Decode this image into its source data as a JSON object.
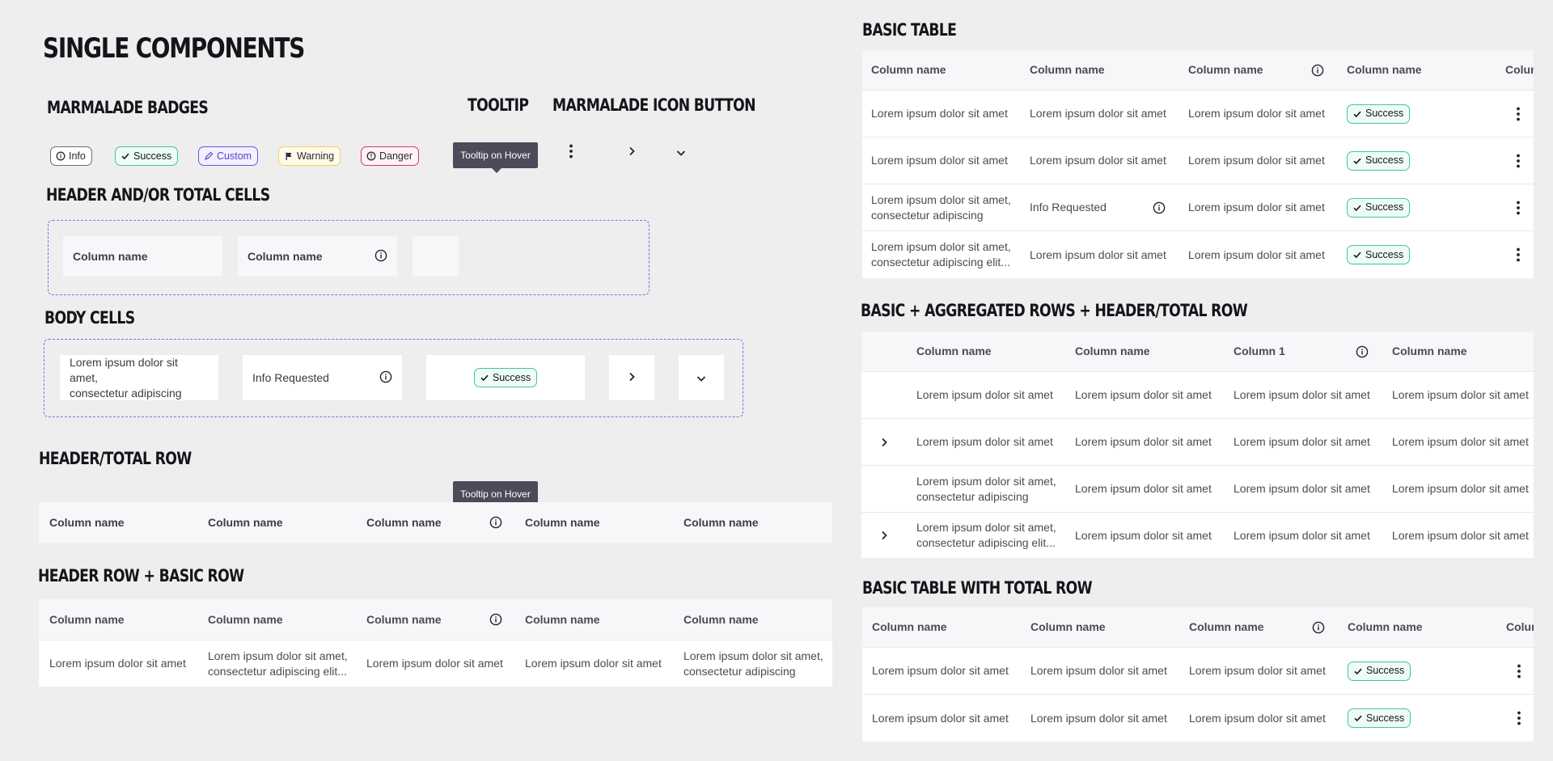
{
  "titles": {
    "single_components": "SINGLE COMPONENTS",
    "badges": "MARMALADE BADGES",
    "tooltip": "TOOLTIP",
    "icon_button": "MARMALADE ICON BUTTON",
    "header_cells": "HEADER AND/OR TOTAL CELLS",
    "body_cells": "BODY CELLS",
    "header_total_row": "HEADER/TOTAL ROW",
    "header_basic_row": "HEADER ROW + BASIC ROW",
    "basic_table": "BASIC TABLE",
    "aggregated": "BASIC + AGGREGATED ROWS + HEADER/TOTAL ROW",
    "total_row_table": "BASIC TABLE WITH TOTAL ROW"
  },
  "badges": {
    "info": "Info",
    "success": "Success",
    "custom": "Custom",
    "warning": "Warning",
    "danger": "Danger"
  },
  "tooltip_text": "Tooltip on Hover",
  "spacing_tag": "4px",
  "text": {
    "column_name": "Column name",
    "column_1": "Column 1",
    "lorem": "Lorem ipsum dolor sit amet",
    "lorem_two_line_a": "Lorem ipsum dolor sit amet,",
    "lorem_two_line_b": "consectetur adipiscing",
    "lorem_two_line_b_elided": "consectetur adipiscing elit...",
    "info_requested": "Info Requested",
    "column_truncated": "Colum"
  },
  "icons": {
    "info": "info-circle-icon",
    "check": "check-icon",
    "custom": "pen-icon",
    "warning": "flag-icon",
    "danger": "alert-circle-icon",
    "kebab": "kebab-vertical-icon",
    "chevron_right": "chevron-right-icon",
    "chevron_down": "chevron-down-icon"
  },
  "colors": {
    "background": "#eeeeef",
    "success": "#3fc79a",
    "custom": "#6b57d9",
    "warning": "#f3d35c",
    "danger": "#d13a5a",
    "frame_dashed": "#7b6cf0",
    "tooltip": "#4c4b5a",
    "tag": "#e83e8c"
  }
}
